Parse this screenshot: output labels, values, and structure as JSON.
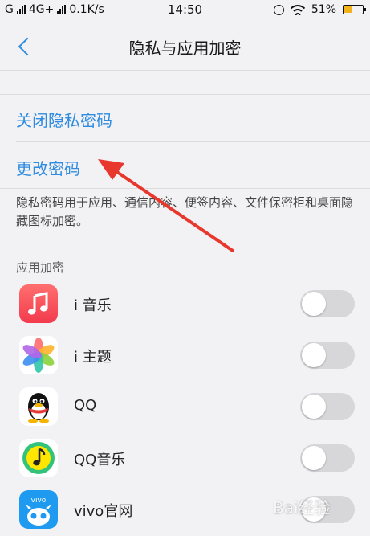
{
  "status_bar": {
    "carrier_left": "G",
    "network": "4G+",
    "speed": "0.1K/s",
    "time": "14:50",
    "battery": "51%",
    "battery_level": 0.51
  },
  "nav": {
    "title": "隐私与应用加密"
  },
  "links": [
    {
      "label": "关闭隐私密码"
    },
    {
      "label": "更改密码"
    }
  ],
  "description": "隐私密码用于应用、通信内容、便签内容、文件保密柜和桌面隐藏图标加密。",
  "section": {
    "label": "应用加密"
  },
  "apps": [
    {
      "name": "i 音乐",
      "icon": "music-note-icon",
      "enabled": false
    },
    {
      "name": "i 主题",
      "icon": "theme-pinwheel-icon",
      "enabled": false
    },
    {
      "name": "QQ",
      "icon": "qq-penguin-icon",
      "enabled": false
    },
    {
      "name": "QQ音乐",
      "icon": "qq-music-icon",
      "enabled": false
    },
    {
      "name": "vivo官网",
      "icon": "vivo-official-icon",
      "enabled": false
    }
  ],
  "annotation": {
    "type": "red-arrow",
    "points_to": "更改密码",
    "color": "#e8372c"
  },
  "watermark": "Bai经验",
  "colors": {
    "accent": "#2f8ce0",
    "background": "#f2f2f4",
    "toggle_off": "#d7d7da"
  }
}
